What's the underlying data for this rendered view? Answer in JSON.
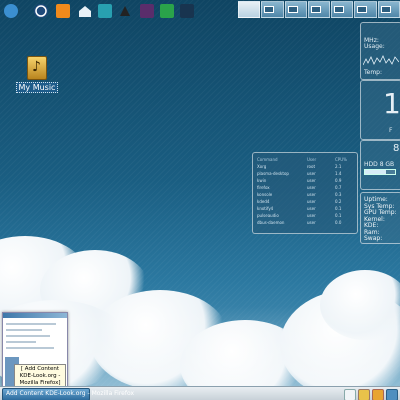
{
  "desktop": {
    "icons": [
      {
        "label": "My Music",
        "icon": "music-folder-icon"
      }
    ]
  },
  "launcher": {
    "icons": [
      "kmenu-icon",
      "globe-icon",
      "settings-icon",
      "home-icon",
      "package-icon",
      "terminal-icon",
      "media-icon",
      "network-icon",
      "apps-icon"
    ]
  },
  "pager": {
    "desktops": 7,
    "active": 0
  },
  "widgets": {
    "cpu": {
      "line1": "MHz:",
      "line2": "Usage:",
      "line3": "Temp:"
    },
    "clock": {
      "hour": "1",
      "small": "F"
    },
    "hdd": {
      "label": "HDD",
      "value": "8 GB",
      "number": "8"
    },
    "system": {
      "rows": [
        "Uptime:",
        "Sys Temp:",
        "GPU Temp:",
        "Kernel:",
        "KDE:",
        "Ram:",
        "Swap:"
      ]
    },
    "processes": {
      "headers": [
        "Command",
        "User",
        "CPU%"
      ],
      "rows": [
        [
          "Xorg",
          "root",
          "2.1"
        ],
        [
          "plasma-desktop",
          "user",
          "1.4"
        ],
        [
          "kwin",
          "user",
          "0.9"
        ],
        [
          "firefox",
          "user",
          "0.7"
        ],
        [
          "konsole",
          "user",
          "0.3"
        ],
        [
          "kded4",
          "user",
          "0.2"
        ],
        [
          "knotify4",
          "user",
          "0.1"
        ],
        [
          "pulseaudio",
          "user",
          "0.1"
        ],
        [
          "dbus-daemon",
          "user",
          "0.0"
        ]
      ]
    }
  },
  "taskbar": {
    "task_label": "Add Content KDE-Look.org - Mozilla Firefox",
    "tooltip": "[ Add Content KDE-Look.org - Mozilla Firefox]"
  },
  "colors": {
    "taskbar_active": "#2d6c9e",
    "desktop_top": "#0f4563",
    "desktop_bottom": "#5a9dc0"
  }
}
